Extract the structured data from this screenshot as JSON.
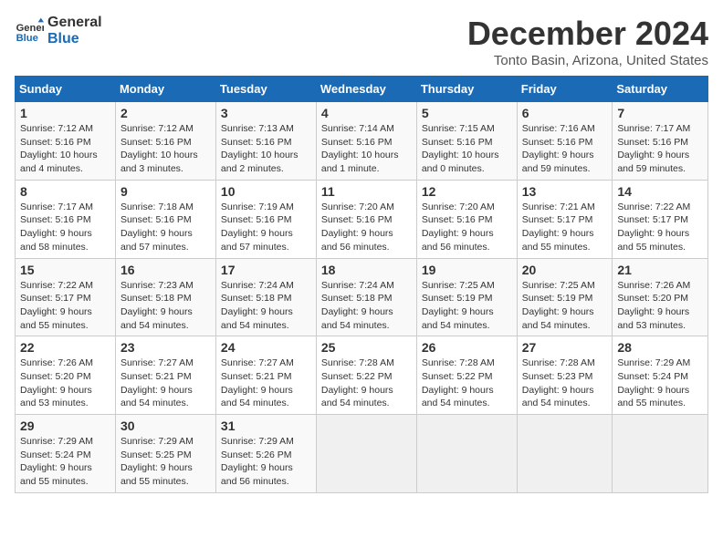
{
  "logo": {
    "line1": "General",
    "line2": "Blue"
  },
  "title": "December 2024",
  "location": "Tonto Basin, Arizona, United States",
  "days_of_week": [
    "Sunday",
    "Monday",
    "Tuesday",
    "Wednesday",
    "Thursday",
    "Friday",
    "Saturday"
  ],
  "weeks": [
    [
      {
        "day": "1",
        "info": "Sunrise: 7:12 AM\nSunset: 5:16 PM\nDaylight: 10 hours\nand 4 minutes."
      },
      {
        "day": "2",
        "info": "Sunrise: 7:12 AM\nSunset: 5:16 PM\nDaylight: 10 hours\nand 3 minutes."
      },
      {
        "day": "3",
        "info": "Sunrise: 7:13 AM\nSunset: 5:16 PM\nDaylight: 10 hours\nand 2 minutes."
      },
      {
        "day": "4",
        "info": "Sunrise: 7:14 AM\nSunset: 5:16 PM\nDaylight: 10 hours\nand 1 minute."
      },
      {
        "day": "5",
        "info": "Sunrise: 7:15 AM\nSunset: 5:16 PM\nDaylight: 10 hours\nand 0 minutes."
      },
      {
        "day": "6",
        "info": "Sunrise: 7:16 AM\nSunset: 5:16 PM\nDaylight: 9 hours\nand 59 minutes."
      },
      {
        "day": "7",
        "info": "Sunrise: 7:17 AM\nSunset: 5:16 PM\nDaylight: 9 hours\nand 59 minutes."
      }
    ],
    [
      {
        "day": "8",
        "info": "Sunrise: 7:17 AM\nSunset: 5:16 PM\nDaylight: 9 hours\nand 58 minutes."
      },
      {
        "day": "9",
        "info": "Sunrise: 7:18 AM\nSunset: 5:16 PM\nDaylight: 9 hours\nand 57 minutes."
      },
      {
        "day": "10",
        "info": "Sunrise: 7:19 AM\nSunset: 5:16 PM\nDaylight: 9 hours\nand 57 minutes."
      },
      {
        "day": "11",
        "info": "Sunrise: 7:20 AM\nSunset: 5:16 PM\nDaylight: 9 hours\nand 56 minutes."
      },
      {
        "day": "12",
        "info": "Sunrise: 7:20 AM\nSunset: 5:16 PM\nDaylight: 9 hours\nand 56 minutes."
      },
      {
        "day": "13",
        "info": "Sunrise: 7:21 AM\nSunset: 5:17 PM\nDaylight: 9 hours\nand 55 minutes."
      },
      {
        "day": "14",
        "info": "Sunrise: 7:22 AM\nSunset: 5:17 PM\nDaylight: 9 hours\nand 55 minutes."
      }
    ],
    [
      {
        "day": "15",
        "info": "Sunrise: 7:22 AM\nSunset: 5:17 PM\nDaylight: 9 hours\nand 55 minutes."
      },
      {
        "day": "16",
        "info": "Sunrise: 7:23 AM\nSunset: 5:18 PM\nDaylight: 9 hours\nand 54 minutes."
      },
      {
        "day": "17",
        "info": "Sunrise: 7:24 AM\nSunset: 5:18 PM\nDaylight: 9 hours\nand 54 minutes."
      },
      {
        "day": "18",
        "info": "Sunrise: 7:24 AM\nSunset: 5:18 PM\nDaylight: 9 hours\nand 54 minutes."
      },
      {
        "day": "19",
        "info": "Sunrise: 7:25 AM\nSunset: 5:19 PM\nDaylight: 9 hours\nand 54 minutes."
      },
      {
        "day": "20",
        "info": "Sunrise: 7:25 AM\nSunset: 5:19 PM\nDaylight: 9 hours\nand 54 minutes."
      },
      {
        "day": "21",
        "info": "Sunrise: 7:26 AM\nSunset: 5:20 PM\nDaylight: 9 hours\nand 53 minutes."
      }
    ],
    [
      {
        "day": "22",
        "info": "Sunrise: 7:26 AM\nSunset: 5:20 PM\nDaylight: 9 hours\nand 53 minutes."
      },
      {
        "day": "23",
        "info": "Sunrise: 7:27 AM\nSunset: 5:21 PM\nDaylight: 9 hours\nand 54 minutes."
      },
      {
        "day": "24",
        "info": "Sunrise: 7:27 AM\nSunset: 5:21 PM\nDaylight: 9 hours\nand 54 minutes."
      },
      {
        "day": "25",
        "info": "Sunrise: 7:28 AM\nSunset: 5:22 PM\nDaylight: 9 hours\nand 54 minutes."
      },
      {
        "day": "26",
        "info": "Sunrise: 7:28 AM\nSunset: 5:22 PM\nDaylight: 9 hours\nand 54 minutes."
      },
      {
        "day": "27",
        "info": "Sunrise: 7:28 AM\nSunset: 5:23 PM\nDaylight: 9 hours\nand 54 minutes."
      },
      {
        "day": "28",
        "info": "Sunrise: 7:29 AM\nSunset: 5:24 PM\nDaylight: 9 hours\nand 55 minutes."
      }
    ],
    [
      {
        "day": "29",
        "info": "Sunrise: 7:29 AM\nSunset: 5:24 PM\nDaylight: 9 hours\nand 55 minutes."
      },
      {
        "day": "30",
        "info": "Sunrise: 7:29 AM\nSunset: 5:25 PM\nDaylight: 9 hours\nand 55 minutes."
      },
      {
        "day": "31",
        "info": "Sunrise: 7:29 AM\nSunset: 5:26 PM\nDaylight: 9 hours\nand 56 minutes."
      },
      {
        "day": "",
        "info": ""
      },
      {
        "day": "",
        "info": ""
      },
      {
        "day": "",
        "info": ""
      },
      {
        "day": "",
        "info": ""
      }
    ]
  ]
}
